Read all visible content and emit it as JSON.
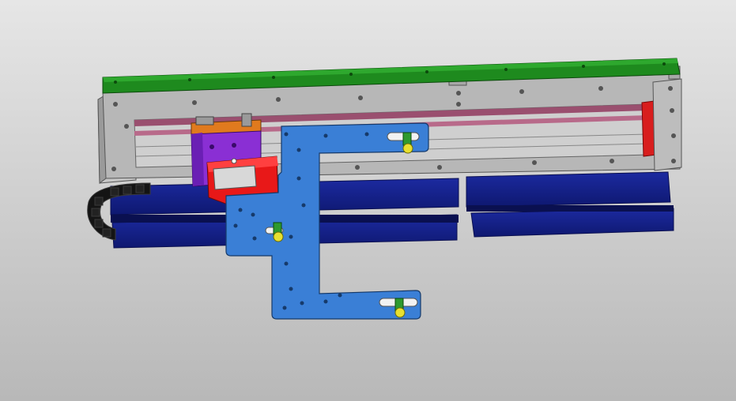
{
  "viewport": {
    "background_top": "#e6e6e6",
    "background_bottom": "#b8b8b8"
  },
  "colors": {
    "top_cover": "#1e8a1e",
    "frame": "#b4b4b4",
    "frame_dark": "#8c8c8c",
    "rail": "#c8c8c8",
    "rail_stripe": "#9a4f6f",
    "end_cap": "#d81e1e",
    "carriage_purple": "#8a2fd4",
    "carriage_red": "#e81818",
    "orange_strip": "#e07a1e",
    "blue_bracket": "#3a7fd6",
    "navy_block": "#14208a",
    "chain_black": "#141414",
    "knob_green": "#2e9a2e",
    "knob_yellow": "#e8e030"
  },
  "model": {
    "parts": [
      {
        "name": "top-cover-plate",
        "color_key": "top_cover"
      },
      {
        "name": "linear-module-frame",
        "color_key": "frame"
      },
      {
        "name": "guide-rail",
        "color_key": "rail"
      },
      {
        "name": "end-cap",
        "color_key": "end_cap"
      },
      {
        "name": "slide-carriage",
        "color_key": "carriage_purple"
      },
      {
        "name": "carriage-block",
        "color_key": "carriage_red"
      },
      {
        "name": "mounting-bracket",
        "color_key": "blue_bracket"
      },
      {
        "name": "base-blocks",
        "color_key": "navy_block"
      },
      {
        "name": "cable-drag-chain",
        "color_key": "chain_black"
      },
      {
        "name": "clamp-knobs",
        "color_key": "knob_yellow"
      }
    ]
  }
}
